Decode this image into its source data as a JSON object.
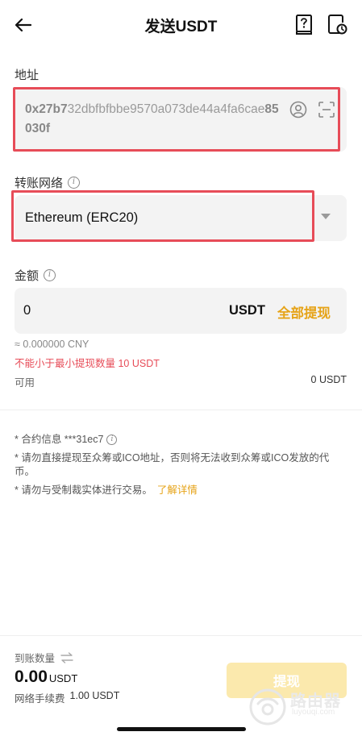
{
  "header": {
    "title": "发送USDT"
  },
  "address": {
    "label": "地址",
    "value_prefix": "0x27b7",
    "value_middle_line1": "32dbfbfbbe9570a073de44a4f",
    "value_middle_line2": "a6cae",
    "value_suffix": "85030f"
  },
  "network": {
    "label": "转账网络",
    "selected": "Ethereum (ERC20)"
  },
  "amount": {
    "label": "金额",
    "value": "0",
    "unit": "USDT",
    "all_label": "全部提现",
    "cny": "≈ 0.000000 CNY",
    "warning": "不能小于最小提现数量 10 USDT",
    "available_label": "可用",
    "available_value": "0 USDT"
  },
  "notes": {
    "contract": "* 合约信息 ***31ec7",
    "ico_warning": "* 请勿直接提现至众筹或ICO地址，否则将无法收到众筹或ICO发放的代币。",
    "sanction_warning": "* 请勿与受制裁实体进行交易。",
    "learn_more": "了解详情"
  },
  "footer": {
    "receive_label": "到账数量",
    "receive_amount": "0.00",
    "receive_unit": "USDT",
    "fee_label": "网络手续费",
    "fee_value": "1.00 USDT",
    "submit_label": "提现"
  },
  "watermark": {
    "text": "路由器",
    "sub": "luyouqi.com"
  },
  "colors": {
    "accent": "#e6a317",
    "warning": "#e74c58",
    "button_disabled": "#fbe9ad"
  }
}
